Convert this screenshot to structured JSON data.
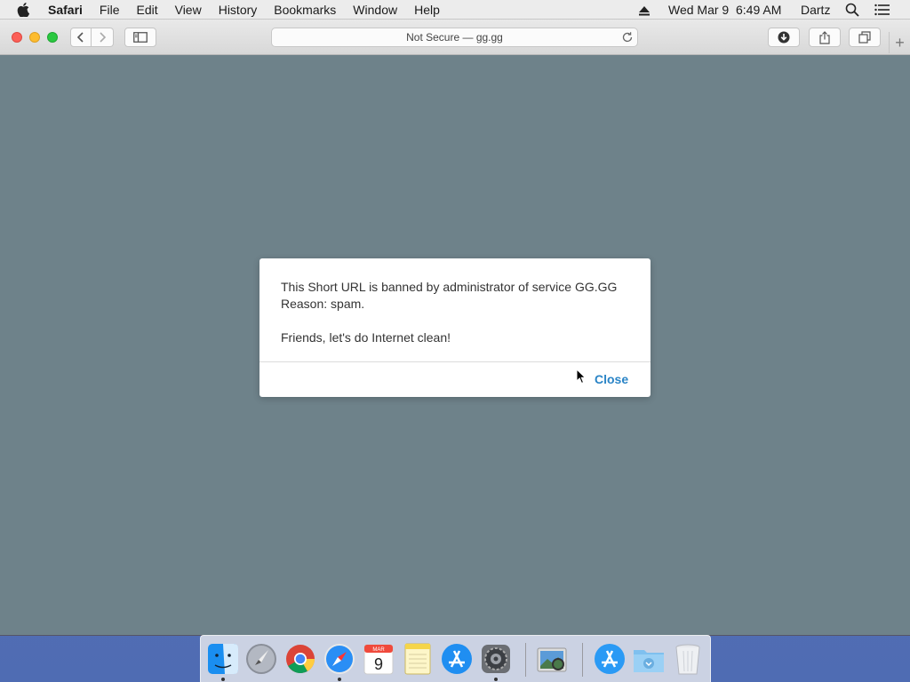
{
  "menubar": {
    "app": "Safari",
    "items": [
      "File",
      "Edit",
      "View",
      "History",
      "Bookmarks",
      "Window",
      "Help"
    ],
    "clock": "Wed Mar 9  6:49 AM",
    "user": "Dartz"
  },
  "browser": {
    "address": "Not Secure — gg.gg"
  },
  "modal": {
    "line1": "This Short URL is banned by administrator of service GG.GG",
    "line2": "Reason: spam.",
    "line3": "Friends, let's do Internet clean!",
    "close_label": "Close"
  },
  "dock": {
    "calendar_month": "MAR",
    "calendar_day": "9"
  },
  "colors": {
    "page_background": "#6e828a",
    "link_blue": "#2a84c6"
  }
}
